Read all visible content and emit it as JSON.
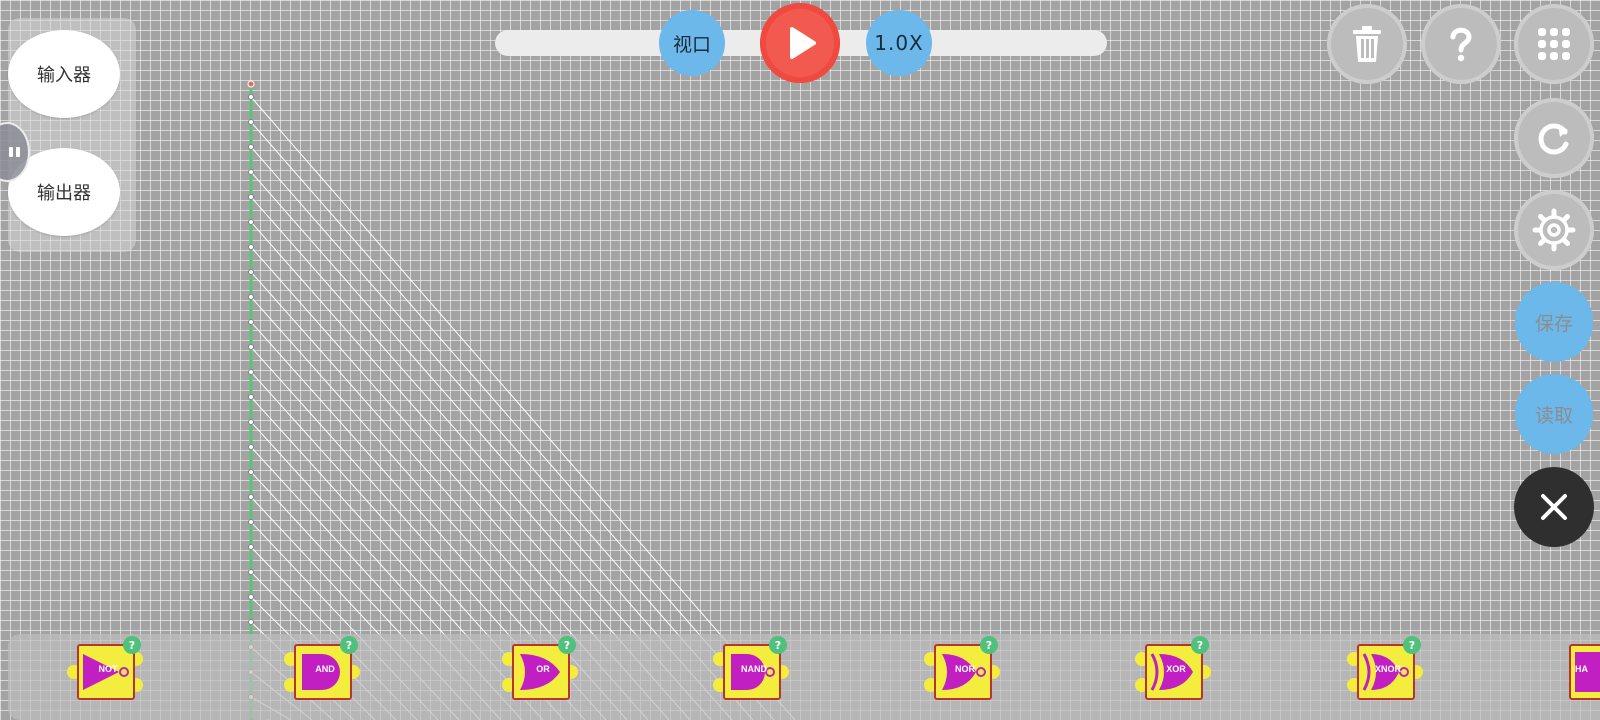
{
  "left_panel": {
    "input_label": "输入器",
    "output_label": "输出器"
  },
  "top_bar": {
    "view_label": "视口",
    "speed_label": "1.0X"
  },
  "right_panel": {
    "save_label": "保存",
    "load_label": "读取"
  },
  "toolbox": {
    "gates": [
      {
        "label": "NOT",
        "help": "?"
      },
      {
        "label": "AND",
        "help": "?"
      },
      {
        "label": "OR",
        "help": "?"
      },
      {
        "label": "NAND",
        "help": "?"
      },
      {
        "label": "NOR",
        "help": "?"
      },
      {
        "label": "XOR",
        "help": "?"
      },
      {
        "label": "XNOR",
        "help": "?"
      },
      {
        "label": "HA",
        "help": ""
      }
    ]
  },
  "colors": {
    "accent_blue": "#6cb8ea",
    "play_red": "#f25a4f",
    "gate_yellow": "#f3ee3d",
    "gate_magenta": "#c21fc2",
    "help_green": "#4fc17d"
  }
}
